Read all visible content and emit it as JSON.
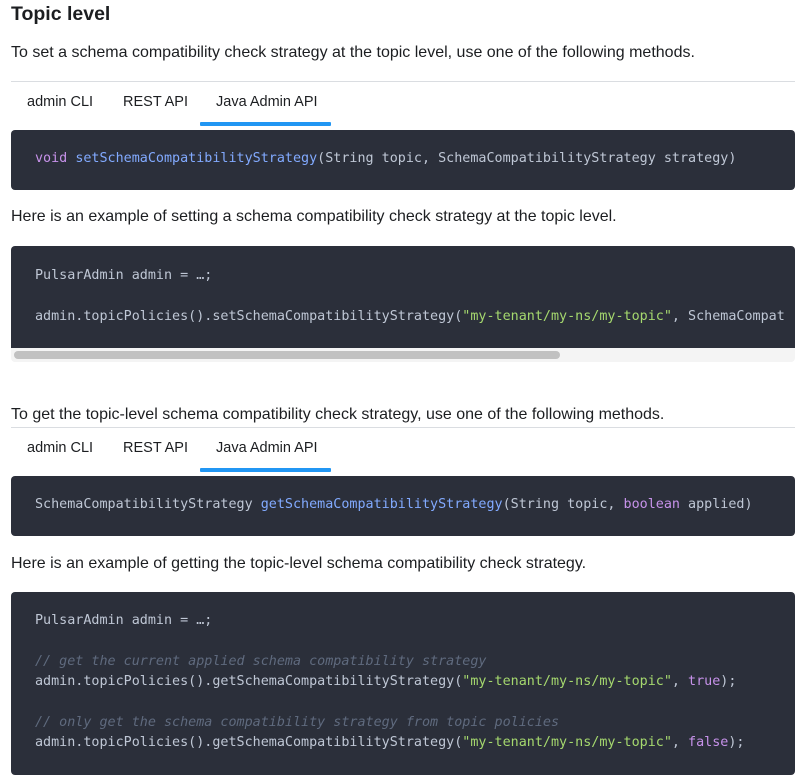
{
  "section": {
    "title": "Topic level",
    "intro_set": "To set a schema compatibility check strategy at the topic level, use one of the following methods.",
    "example_set": "Here is an example of setting a schema compatibility check strategy at the topic level.",
    "intro_get": "To get the topic-level schema compatibility check strategy, use one of the following methods.",
    "example_get": "Here is an example of getting the topic-level schema compatibility check strategy."
  },
  "tabs_set": [
    {
      "label": "admin CLI",
      "active": false
    },
    {
      "label": "REST API",
      "active": false
    },
    {
      "label": "Java Admin API",
      "active": true
    }
  ],
  "tabs_get": [
    {
      "label": "admin CLI",
      "active": false
    },
    {
      "label": "REST API",
      "active": false
    },
    {
      "label": "Java Admin API",
      "active": true
    }
  ],
  "code": {
    "set_sig": {
      "kw": "void",
      "fn": "setSchemaCompatibilityStrategy",
      "rest": "(String topic, SchemaCompatibilityStrategy strategy)"
    },
    "set_example": {
      "line1": "PulsarAdmin admin = …;",
      "line2_pre": "admin.topicPolicies().setSchemaCompatibilityStrategy(",
      "line2_str": "\"my-tenant/my-ns/my-topic\"",
      "line2_post": ", SchemaCompat"
    },
    "get_sig": {
      "pre": "SchemaCompatibilityStrategy ",
      "fn": "getSchemaCompatibilityStrategy",
      "mid": "(String topic, ",
      "kw": "boolean",
      "post": " applied)"
    },
    "get_example": {
      "line1": "PulsarAdmin admin = …;",
      "comment1": "// get the current applied schema compatibility strategy",
      "line2_pre": "admin.topicPolicies().getSchemaCompatibilityStrategy(",
      "line2_str": "\"my-tenant/my-ns/my-topic\"",
      "line2_sep": ", ",
      "line2_bool": "true",
      "line2_end": ");",
      "comment2": "// only get the schema compatibility strategy from topic policies",
      "line3_pre": "admin.topicPolicies().getSchemaCompatibilityStrategy(",
      "line3_str": "\"my-tenant/my-ns/my-topic\"",
      "line3_sep": ", ",
      "line3_bool": "false",
      "line3_end": ");"
    }
  },
  "colors": {
    "accent": "#2196f3",
    "code_bg": "#2b2f3a",
    "keyword": "#c792ea",
    "function": "#82aaff",
    "string": "#a5d86e",
    "comment": "#5f6a7e"
  }
}
